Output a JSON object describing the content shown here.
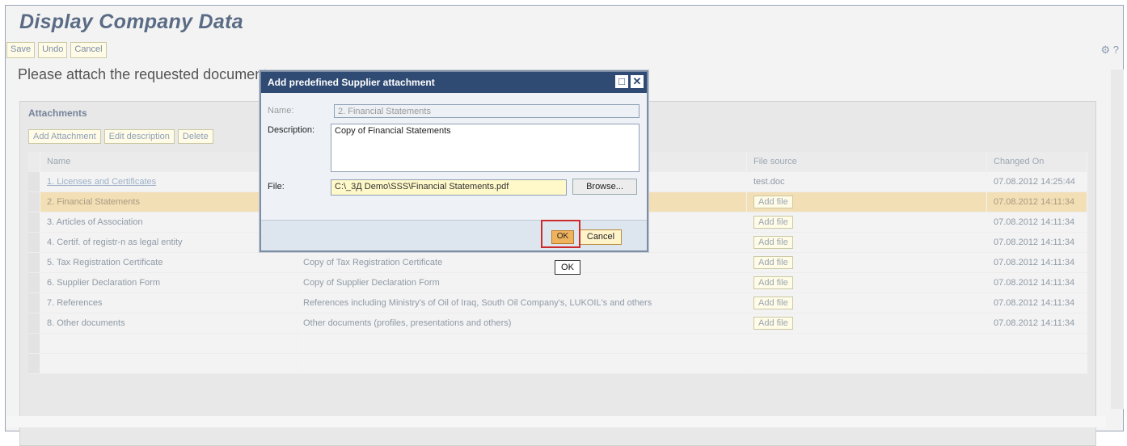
{
  "window": {
    "title": "Display Company Data"
  },
  "toolbar": {
    "save": "Save",
    "undo": "Undo",
    "cancel": "Cancel"
  },
  "instruction": "Please attach the requested documents",
  "attachments": {
    "title": "Attachments",
    "buttons": [
      "Add Attachment",
      "Edit description",
      "Delete"
    ],
    "columns": {
      "name": "Name",
      "file_source": "File source",
      "changed_on": "Changed On"
    },
    "rows": [
      {
        "name": "1. Licenses and Certificates",
        "description": "",
        "file_source": "test.doc",
        "changed_on": "07.08.2012 14:25:44",
        "link": true
      },
      {
        "name": "2. Financial Statements",
        "description": "",
        "file_source": "Add file",
        "changed_on": "07.08.2012 14:11:34",
        "selected": true
      },
      {
        "name": "3. Articles of Association",
        "description": "",
        "file_source": "Add file",
        "changed_on": "07.08.2012 14:11:34"
      },
      {
        "name": "4. Certif. of registr-n as legal entity",
        "description": "",
        "file_source": "Add file",
        "changed_on": "07.08.2012 14:11:34"
      },
      {
        "name": "5. Tax Registration Certificate",
        "description": "Copy of Tax Registration Certificate",
        "file_source": "Add file",
        "changed_on": "07.08.2012 14:11:34"
      },
      {
        "name": "6. Supplier Declaration Form",
        "description": "Copy of Supplier Declaration Form",
        "file_source": "Add file",
        "changed_on": "07.08.2012 14:11:34"
      },
      {
        "name": "7. References",
        "description": "References including Ministry's of Oil of Iraq, South Oil Company's, LUKOIL's and others",
        "file_source": "Add file",
        "changed_on": "07.08.2012 14:11:34"
      },
      {
        "name": "8. Other documents",
        "description": "Other documents (profiles, presentations and others)",
        "file_source": "Add file",
        "changed_on": "07.08.2012 14:11:34"
      }
    ]
  },
  "dialog": {
    "title": "Add predefined Supplier attachment",
    "name_label": "Name:",
    "name_value": "2. Financial Statements",
    "description_label": "Description:",
    "description_value": "Copy of Financial Statements",
    "file_label": "File:",
    "file_value": "C:\\_3Д Demo\\SSS\\Financial Statements.pdf",
    "browse": "Browse...",
    "ok": "OK",
    "cancel": "Cancel"
  },
  "tooltip": "OK",
  "colors": {
    "dialog_header": "#2f4a73",
    "highlight": "#cc2b2b",
    "selected_row": "#f3dfb5"
  }
}
